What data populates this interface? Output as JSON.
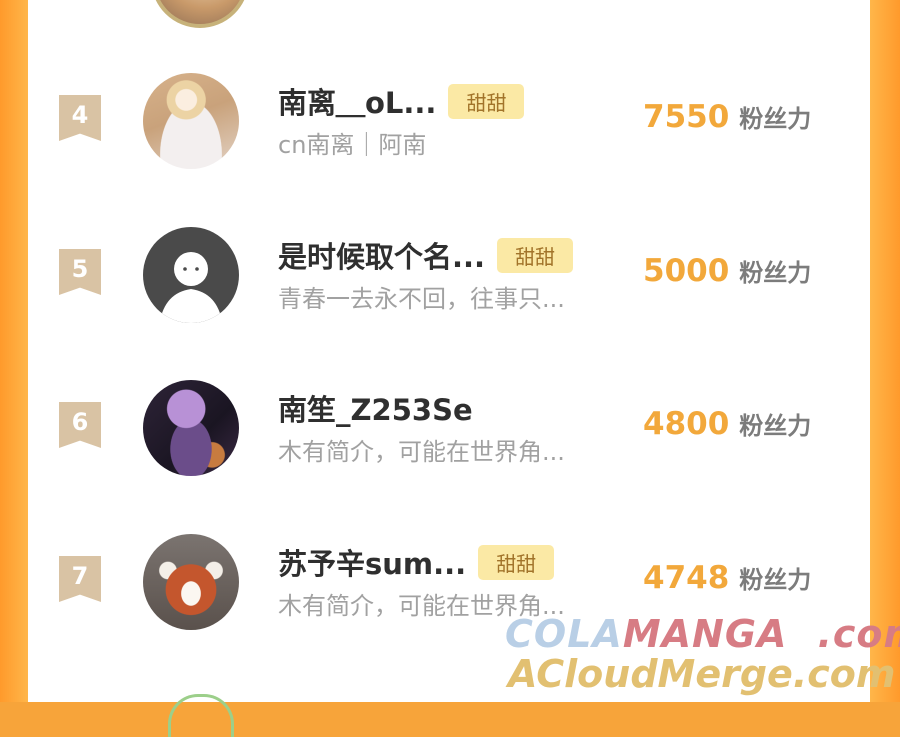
{
  "badge_label": "甜甜",
  "unit_label": "粉丝力",
  "rows": [
    {
      "rank": "4",
      "name": "南离＿oL...",
      "badge": "甜甜",
      "bio": "cn南离｜阿南",
      "score": "7550",
      "unit": "粉丝力"
    },
    {
      "rank": "5",
      "name": "是时候取个名...",
      "badge": "甜甜",
      "bio": "青春一去永不回，往事只...",
      "score": "5000",
      "unit": "粉丝力"
    },
    {
      "rank": "6",
      "name": "南笙_Z253Se",
      "badge": "",
      "bio": "木有简介，可能在世界角...",
      "score": "4800",
      "unit": "粉丝力"
    },
    {
      "rank": "7",
      "name": "苏予辛sum...",
      "badge": "甜甜",
      "bio": "木有简介，可能在世界角...",
      "score": "4748",
      "unit": "粉丝力"
    }
  ],
  "watermark": {
    "line1_a": "COLA",
    "line1_b": "MANGA",
    "line1_c": ".com",
    "line2": "ACloudMerge.com"
  },
  "colors": {
    "accent_orange": "#f2a83b",
    "rank_badge": "#d9c3a4",
    "badge_bg": "#fbe9a5",
    "frame": "#f7a43a"
  },
  "icons": {
    "rank_marker": "ribbon-bookmark",
    "default_avatar": "person-silhouette"
  }
}
